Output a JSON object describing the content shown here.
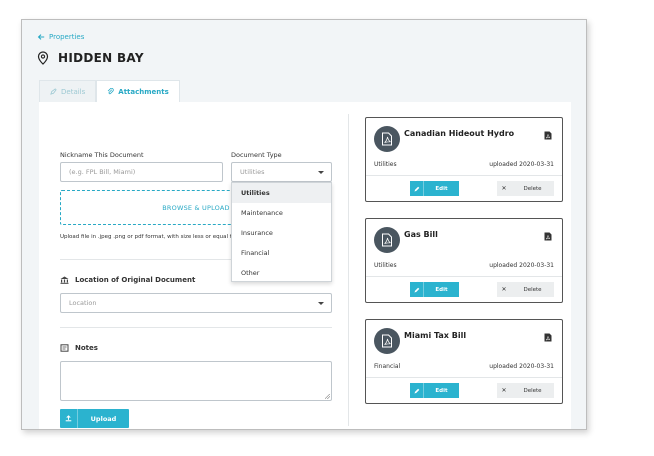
{
  "nav": {
    "back_label": "Properties"
  },
  "property": {
    "title": "HIDDEN BAY"
  },
  "tabs": [
    {
      "label": "Details",
      "icon": "pencil-icon",
      "active": false
    },
    {
      "label": "Attachments",
      "icon": "paperclip-icon",
      "active": true
    }
  ],
  "form": {
    "nickname_label": "Nickname This Document",
    "nickname_placeholder": "(e.g. FPL Bill, Miami)",
    "doctype_label": "Document Type",
    "doctype_value": "Utilities",
    "doctype_options": [
      "Utilities",
      "Maintenance",
      "Insurance",
      "Financial",
      "Other"
    ],
    "dropzone_label": "BROWSE & UPLOAD",
    "upload_hint": "Upload file in .jpeg .png or pdf format, with size less or equal to 10M",
    "location_title": "Location of Original Document",
    "location_placeholder": "Location",
    "notes_title": "Notes",
    "upload_button": "Upload"
  },
  "documents": [
    {
      "name": "Canadian Hideout Hydro",
      "category": "Utilities",
      "uploaded": "uploaded 2020-03-31",
      "edit_label": "Edit",
      "delete_label": "Delete"
    },
    {
      "name": "Gas Bill",
      "category": "Utilities",
      "uploaded": "uploaded 2020-03-31",
      "edit_label": "Edit",
      "delete_label": "Delete"
    },
    {
      "name": "Miami Tax Bill",
      "category": "Financial",
      "uploaded": "uploaded 2020-03-31",
      "edit_label": "Edit",
      "delete_label": "Delete"
    }
  ],
  "colors": {
    "accent": "#2bb3cf",
    "avatar": "#4a5660",
    "text": "#333333"
  }
}
